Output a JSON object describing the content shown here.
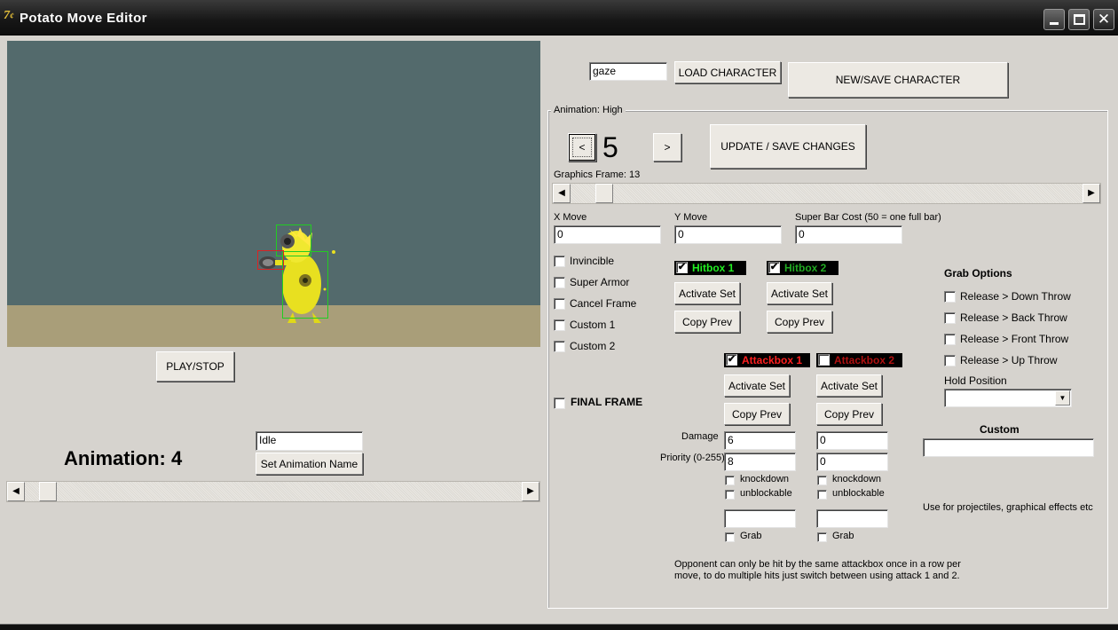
{
  "window": {
    "title": "Potato Move Editor",
    "icon_letter": "7"
  },
  "top": {
    "character_name": "gaze",
    "load_button": "LOAD CHARACTER",
    "new_save_button": "NEW/SAVE CHARACTER"
  },
  "group": {
    "title": "Animation: High"
  },
  "frame": {
    "prev_label": "<",
    "number": "5",
    "next_label": ">",
    "update_button": "UPDATE / SAVE CHANGES",
    "graphics_frame_label": "Graphics Frame: 13"
  },
  "movement": {
    "x_label": "X Move",
    "x_value": "0",
    "y_label": "Y Move",
    "y_value": "0",
    "super_label": "Super Bar Cost (50 = one full bar)",
    "super_value": "0"
  },
  "flags": [
    {
      "label": "Invincible",
      "checked": false
    },
    {
      "label": "Super Armor",
      "checked": false
    },
    {
      "label": "Cancel Frame",
      "checked": false
    },
    {
      "label": "Custom 1",
      "checked": false
    },
    {
      "label": "Custom 2",
      "checked": false
    }
  ],
  "final_frame": {
    "label": "FINAL FRAME",
    "checked": false
  },
  "hitboxes": [
    {
      "label": "Hitbox 1",
      "checked": true,
      "color": "#22ee22",
      "activate": "Activate Set",
      "copy": "Copy Prev"
    },
    {
      "label": "Hitbox 2",
      "checked": true,
      "color": "#22aa22",
      "activate": "Activate Set",
      "copy": "Copy Prev"
    }
  ],
  "attackboxes": [
    {
      "label": "Attackbox 1",
      "checked": true,
      "color": "#ff2020",
      "activate": "Activate Set",
      "copy": "Copy Prev",
      "damage": "6",
      "priority": "8",
      "knockdown": "knockdown",
      "unblockable": "unblockable",
      "extra": "",
      "grab": "Grab"
    },
    {
      "label": "Attackbox 2",
      "checked": false,
      "color": "#b01010",
      "activate": "Activate Set",
      "copy": "Copy Prev",
      "damage": "0",
      "priority": "0",
      "knockdown": "knockdown",
      "unblockable": "unblockable",
      "extra": "",
      "grab": "Grab"
    }
  ],
  "attack_labels": {
    "damage": "Damage",
    "priority": "Priority (0-255)"
  },
  "grab": {
    "title": "Grab Options",
    "options": [
      "Release > Down Throw",
      "Release > Back Throw",
      "Release > Front Throw",
      "Release > Up Throw"
    ],
    "hold_label": "Hold Position",
    "hold_value": ""
  },
  "custom": {
    "title": "Custom",
    "value": "",
    "note": "Use for projectiles, graphical effects etc"
  },
  "note": "Opponent can only be hit by the same attackbox once in a row per move, to do multiple hits just switch between using attack 1 and 2.",
  "left": {
    "play_stop": "PLAY/STOP",
    "animation_label": "Animation: 4",
    "animation_name": "Idle",
    "set_name_button": "Set Animation Name"
  },
  "scroll_arrows": {
    "left": "◀",
    "right": "▶"
  },
  "colors": {
    "sky": "#536a6c",
    "ground": "#a99e79",
    "hitbox": "#22cc22",
    "attackbox": "#dd2222",
    "character": "#e8e020"
  }
}
